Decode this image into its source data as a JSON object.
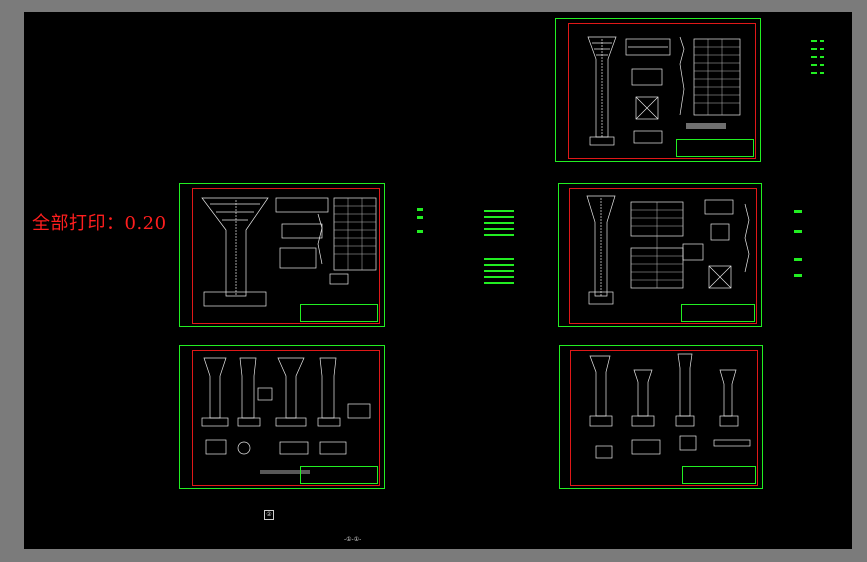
{
  "print_note": "全部打印：0.20",
  "bottom_label": "-①-①-",
  "small_mark": "②",
  "colors": {
    "background": "#000000",
    "sheet_border": "#22ee22",
    "drawing_frame": "#e01818",
    "linework": "#e8e8e8",
    "note": "#ff1e1e"
  }
}
